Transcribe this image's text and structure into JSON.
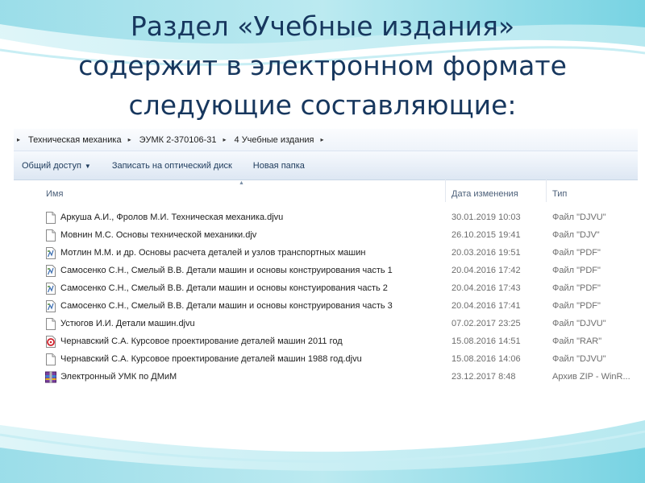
{
  "slide": {
    "title_lines": [
      "Раздел «Учебные издания»",
      "содержит в электронном формате",
      "следующие составляющие:"
    ]
  },
  "explorer": {
    "breadcrumb": [
      "Техническая механика",
      "ЭУМК 2-370106-31",
      "4 Учебные издания"
    ],
    "toolbar": {
      "share_label": "Общий доступ",
      "burn_label": "Записать на оптический диск",
      "new_folder_label": "Новая папка"
    },
    "columns": {
      "name": "Имя",
      "date": "Дата изменения",
      "type": "Тип"
    },
    "files": [
      {
        "name": "Аркуша А.И., Фролов М.И. Техническая механика.djvu",
        "date": "30.01.2019 10:03",
        "type": "Файл \"DJVU\"",
        "icon": "file-icon"
      },
      {
        "name": "Мовнин М.С.  Основы технической механики.djv",
        "date": "26.10.2015 19:41",
        "type": "Файл \"DJV\"",
        "icon": "file-icon"
      },
      {
        "name": "Мотлин М.М. и др. Основы расчета деталей и узлов транспортных машин",
        "date": "20.03.2016 19:51",
        "type": "Файл \"PDF\"",
        "icon": "pdf-icon"
      },
      {
        "name": "Самосенко С.Н., Смелый В.В. Детали машин  и основы конструирования часть 1",
        "date": "20.04.2016 17:42",
        "type": "Файл \"PDF\"",
        "icon": "pdf-icon"
      },
      {
        "name": "Самосенко С.Н., Смелый В.В. Детали машин  и основы констуирования часть 2",
        "date": "20.04.2016 17:43",
        "type": "Файл \"PDF\"",
        "icon": "pdf-icon"
      },
      {
        "name": "Самосенко С.Н., Смелый В.В. Детали машин  и основы конструирования часть 3",
        "date": "20.04.2016 17:41",
        "type": "Файл \"PDF\"",
        "icon": "pdf-icon"
      },
      {
        "name": "Устюгов И.И. Детали машин.djvu",
        "date": "07.02.2017 23:25",
        "type": "Файл \"DJVU\"",
        "icon": "file-icon"
      },
      {
        "name": "Чернавский С.А. Курсовое проектирование деталей машин 2011 год",
        "date": "15.08.2016 14:51",
        "type": "Файл \"RAR\"",
        "icon": "rar-icon"
      },
      {
        "name": "Чернавский С.А. Курсовое проектирование деталей машин 1988 год.djvu",
        "date": "15.08.2016 14:06",
        "type": "Файл \"DJVU\"",
        "icon": "file-icon"
      },
      {
        "name": "Электронный УМК по ДМиМ",
        "date": "23.12.2017 8:48",
        "type": "Архив ZIP - WinR...",
        "icon": "zip-archive-icon"
      }
    ]
  }
}
